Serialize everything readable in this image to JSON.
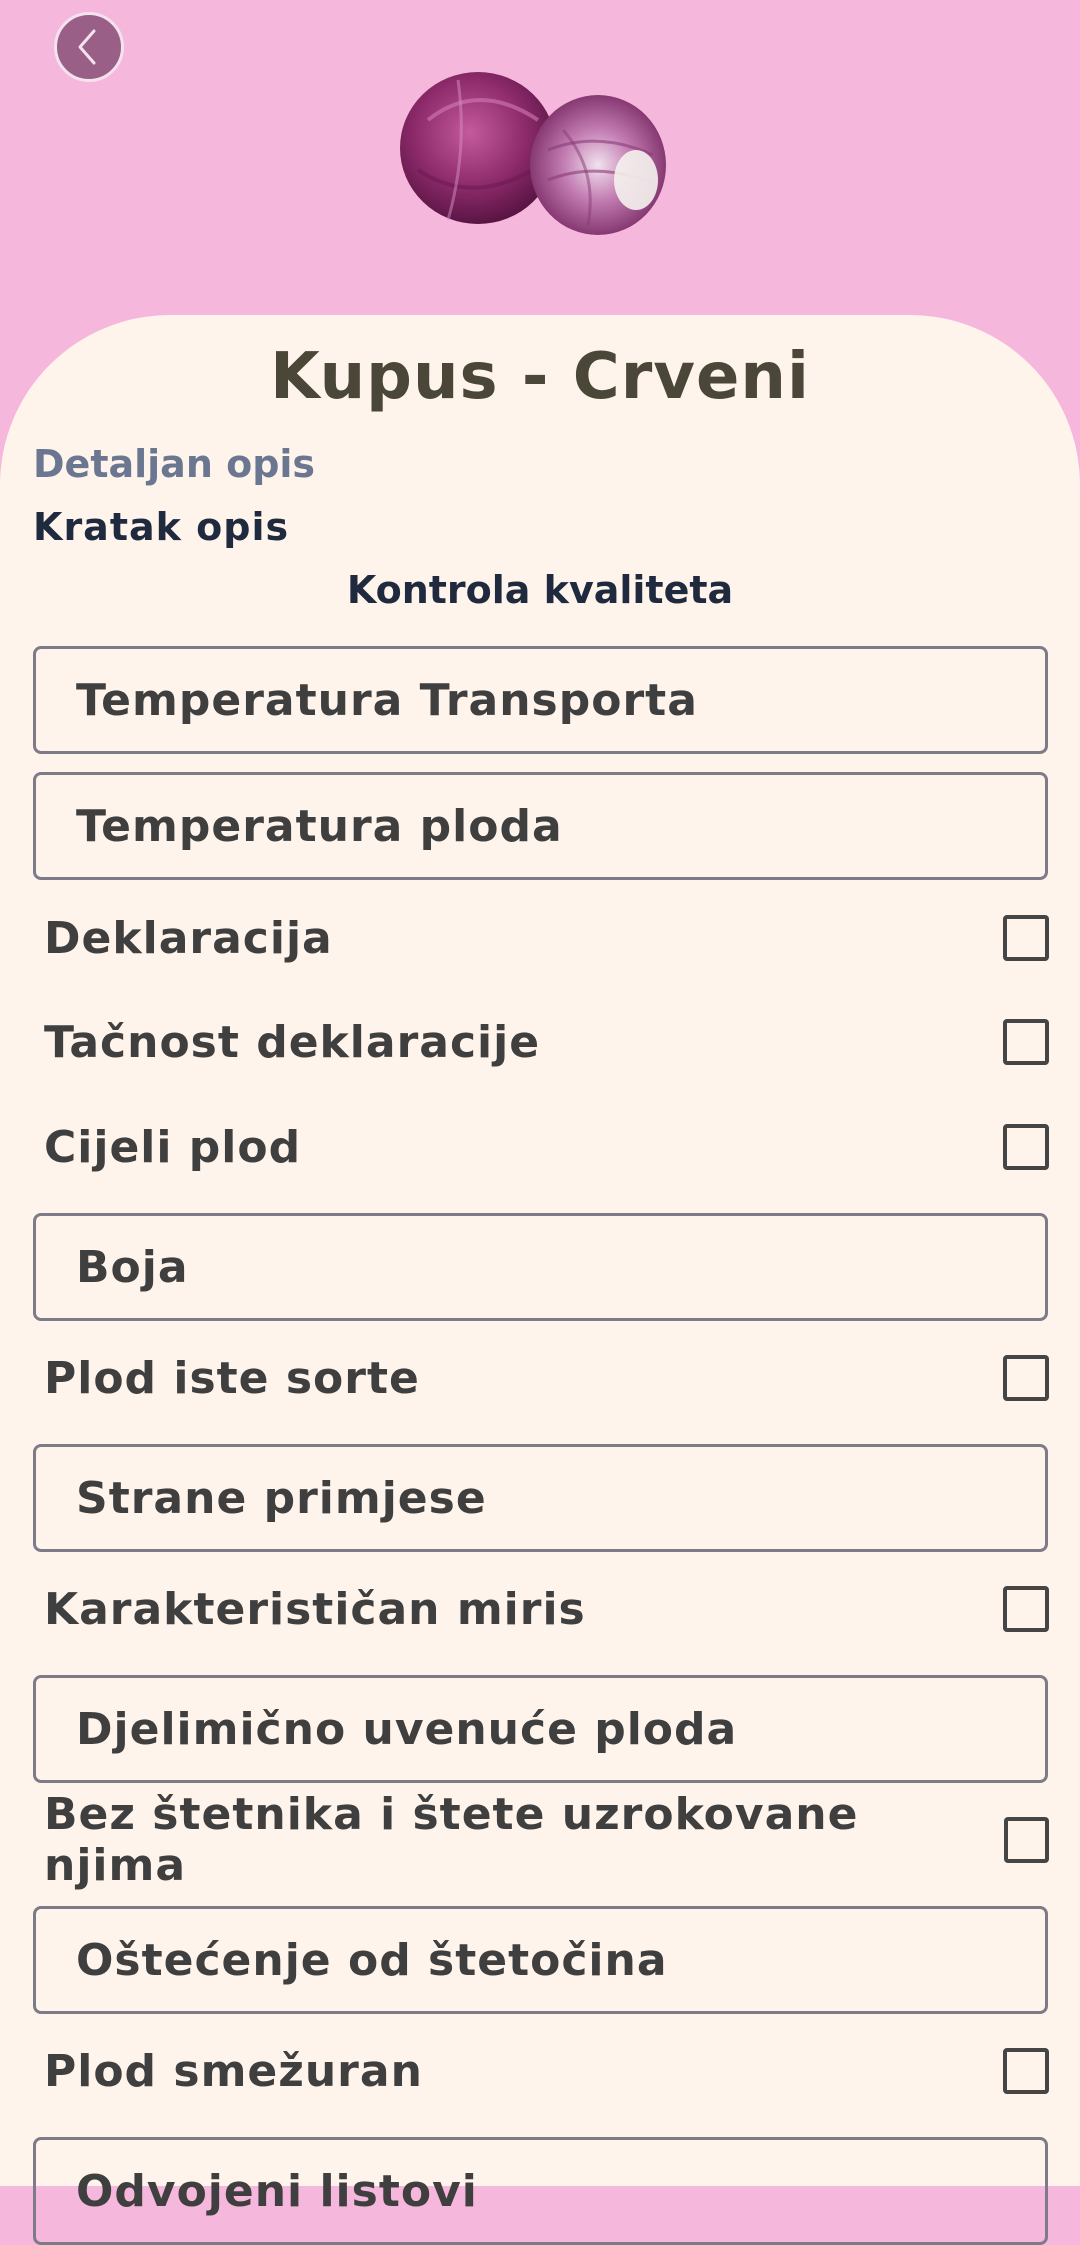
{
  "product": {
    "title": "Kupus - Crveni",
    "detail_link": "Detaljan opis",
    "short_desc": "Kratak opis",
    "section_title": "Kontrola kvaliteta"
  },
  "colors": {
    "header_bg": "#f5b8dc",
    "sheet_bg": "#fff4ec",
    "title": "#4a4638",
    "link": "#6b7690"
  },
  "icons": {
    "back": "chevron-left-icon",
    "hero": "red-cabbage-image"
  },
  "quality_items": [
    {
      "type": "field",
      "label": "Temperatura Transporta"
    },
    {
      "type": "field",
      "label": "Temperatura ploda"
    },
    {
      "type": "check",
      "label": "Deklaracija",
      "checked": false
    },
    {
      "type": "check",
      "label": "Tačnost deklaracije",
      "checked": false
    },
    {
      "type": "check",
      "label": "Cijeli plod",
      "checked": false
    },
    {
      "type": "field",
      "label": "Boja"
    },
    {
      "type": "check",
      "label": "Plod iste sorte",
      "checked": false
    },
    {
      "type": "field",
      "label": "Strane primjese"
    },
    {
      "type": "check",
      "label": "Karakterističan miris",
      "checked": false
    },
    {
      "type": "field",
      "label": "Djelimično uvenuće ploda"
    },
    {
      "type": "check",
      "label": "Bez štetnika i štete uzrokovane njima",
      "checked": false
    },
    {
      "type": "field",
      "label": "Oštećenje od štetočina"
    },
    {
      "type": "check",
      "label": "Plod smežuran",
      "checked": false
    },
    {
      "type": "field",
      "label": "Odvojeni listovi"
    }
  ]
}
